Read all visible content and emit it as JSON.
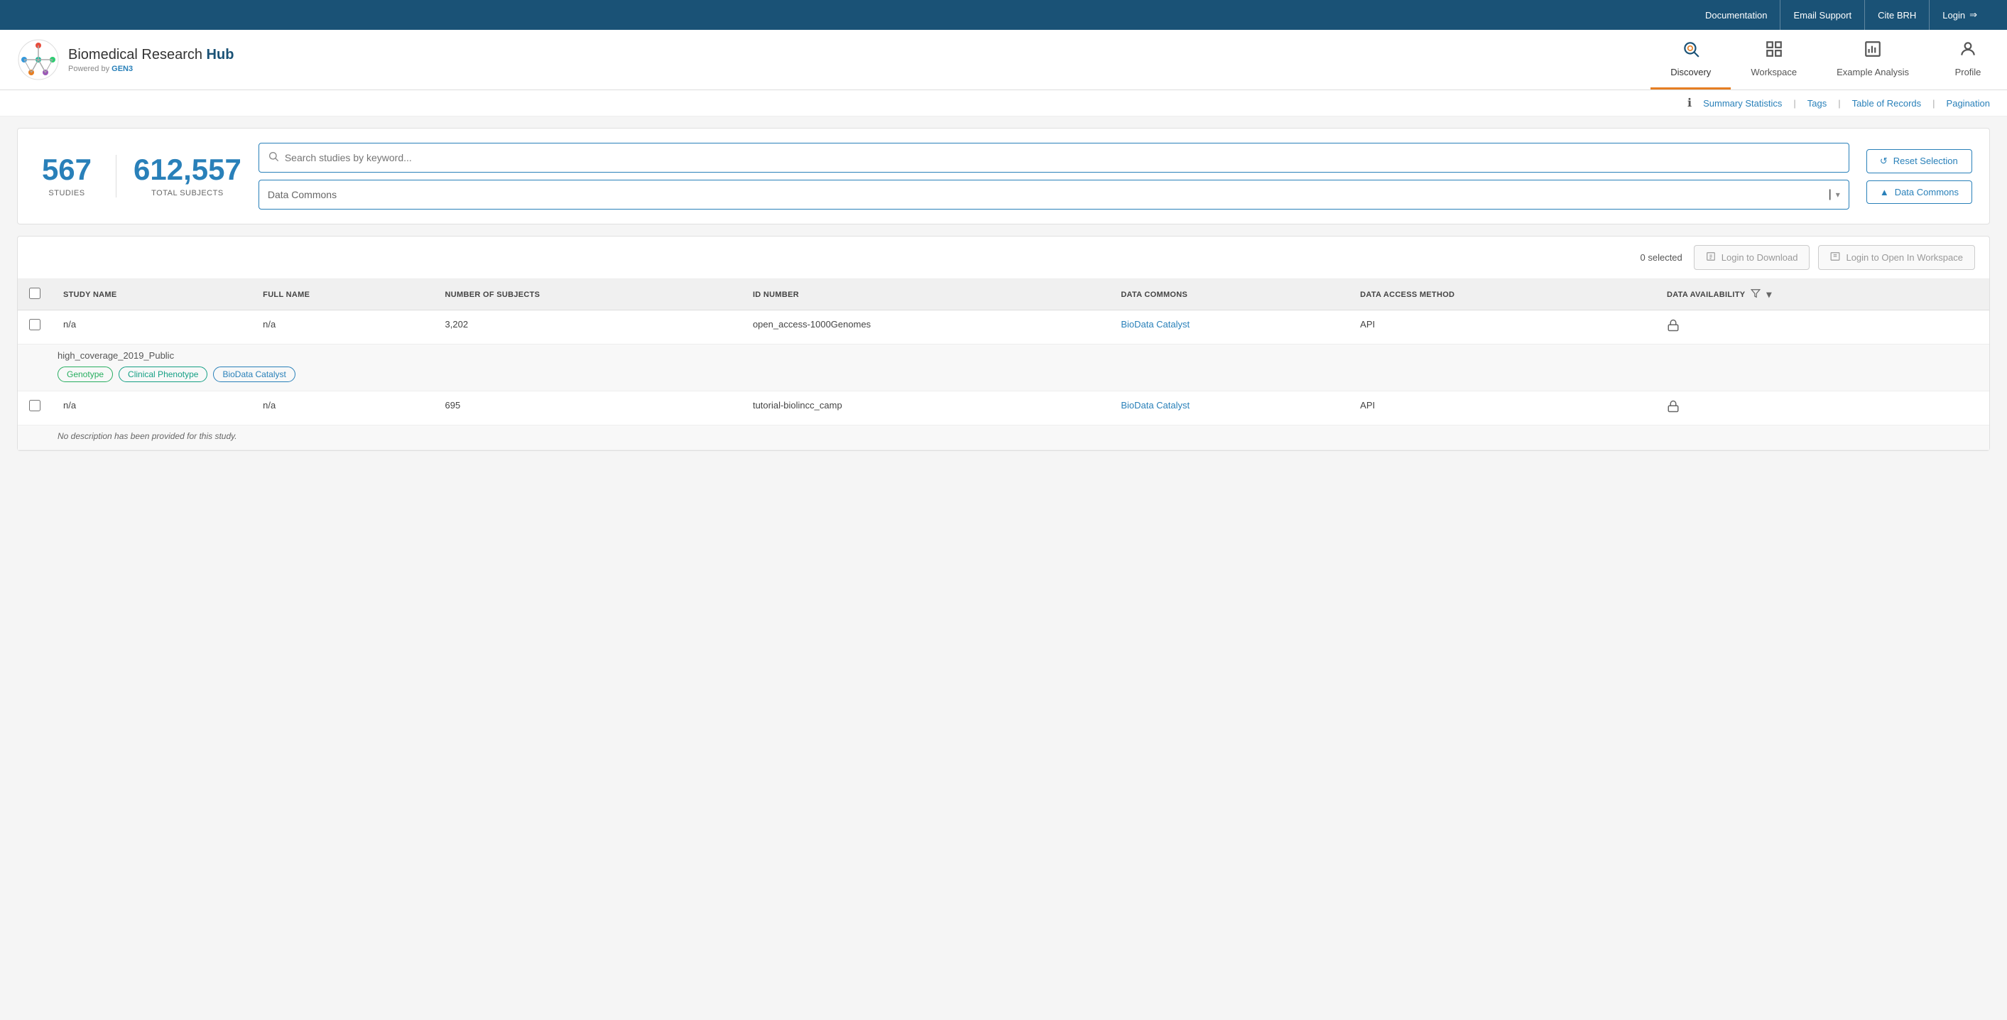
{
  "topbar": {
    "links": [
      "Documentation",
      "Email Support",
      "Cite BRH"
    ],
    "login_label": "Login",
    "login_icon": "→"
  },
  "header": {
    "logo_text_prefix": "Biomedical Research ",
    "logo_text_hub": "Hub",
    "logo_powered": "Powered by GEN3"
  },
  "nav": {
    "tabs": [
      {
        "id": "discovery",
        "label": "Discovery",
        "icon": "🔍",
        "active": true
      },
      {
        "id": "workspace",
        "label": "Workspace",
        "icon": "📊",
        "active": false
      },
      {
        "id": "example-analysis",
        "label": "Example Analysis",
        "icon": "📈",
        "active": false
      },
      {
        "id": "profile",
        "label": "Profile",
        "icon": "👤",
        "active": false
      }
    ]
  },
  "secondary_nav": {
    "help_icon": "?",
    "links": [
      "Summary Statistics",
      "Tags",
      "Table of Records",
      "Pagination"
    ]
  },
  "stats": {
    "studies_count": "567",
    "studies_label": "STUDIES",
    "subjects_count": "612,557",
    "subjects_label": "TOTAL SUBJECTS"
  },
  "search": {
    "placeholder": "Search studies by keyword...",
    "dropdown_placeholder": "Data Commons",
    "dropdown_value": ""
  },
  "buttons": {
    "reset_label": "Reset Selection",
    "reset_icon": "↺",
    "data_commons_label": "Data Commons",
    "data_commons_icon": "▲",
    "login_download_label": "Login to Download",
    "login_download_icon": "📄",
    "login_workspace_label": "Login to Open In Workspace",
    "login_workspace_icon": "📋"
  },
  "table": {
    "selected_count": "0 selected",
    "columns": [
      {
        "id": "study-name",
        "label": "STUDY NAME"
      },
      {
        "id": "full-name",
        "label": "FULL NAME"
      },
      {
        "id": "num-subjects",
        "label": "NUMBER OF SUBJECTS"
      },
      {
        "id": "id-number",
        "label": "ID NUMBER"
      },
      {
        "id": "data-commons",
        "label": "DATA COMMONS"
      },
      {
        "id": "access-method",
        "label": "DATA ACCESS METHOD"
      },
      {
        "id": "availability",
        "label": "DATA AVAILABILITY"
      }
    ],
    "rows": [
      {
        "id": "row1",
        "study_name": "n/a",
        "full_name": "n/a",
        "num_subjects": "3,202",
        "id_number": "open_access-1000Genomes",
        "data_commons": "BioData Catalyst",
        "access_method": "API",
        "availability": "🔒",
        "detail_name": "high_coverage_2019_Public",
        "tags": [
          {
            "label": "Genotype",
            "class": "tag-green"
          },
          {
            "label": "Clinical Phenotype",
            "class": "tag-teal"
          },
          {
            "label": "BioData Catalyst",
            "class": "tag-blue"
          }
        ],
        "description": ""
      },
      {
        "id": "row2",
        "study_name": "n/a",
        "full_name": "n/a",
        "num_subjects": "695",
        "id_number": "tutorial-biolincc_camp",
        "data_commons": "BioData Catalyst",
        "access_method": "API",
        "availability": "🔒",
        "detail_name": "",
        "tags": [],
        "description": "No description has been provided for this study."
      }
    ]
  }
}
